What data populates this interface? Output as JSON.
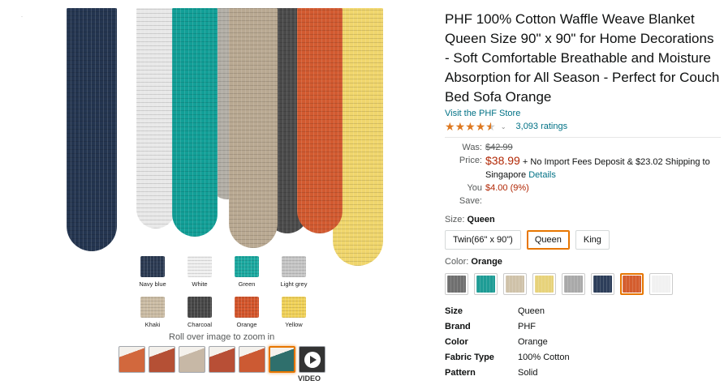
{
  "stray_mark": "·",
  "gallery": {
    "blankets": [
      {
        "color": "#243550"
      },
      {
        "color": "#e8e8e8"
      },
      {
        "color": "#129f97"
      },
      {
        "color": "#b2aea6"
      },
      {
        "color": "#b9a992"
      },
      {
        "color": "#4a4a4a"
      },
      {
        "color": "#d25a30"
      },
      {
        "color": "#f0d66c"
      }
    ],
    "swatches": [
      {
        "label": "Navy blue",
        "color": "#2b3a52"
      },
      {
        "label": "White",
        "color": "#efefef"
      },
      {
        "label": "Green",
        "color": "#1ba9a0"
      },
      {
        "label": "Light grey",
        "color": "#c6c6c6"
      },
      {
        "label": "Khaki",
        "color": "#cbbca4"
      },
      {
        "label": "Charcoal",
        "color": "#474747"
      },
      {
        "label": "Orange",
        "color": "#d4552b"
      },
      {
        "label": "Yellow",
        "color": "#f1d258"
      }
    ],
    "zoom_hint": "Roll over image to zoom in",
    "thumbnails": [
      {
        "color": "#d2683d",
        "selected": false
      },
      {
        "color": "#b55035",
        "selected": false
      },
      {
        "color": "#c7b8a6",
        "selected": false
      },
      {
        "color": "#b84f36",
        "selected": false
      },
      {
        "color": "#cc5a33",
        "selected": false
      },
      {
        "color": "#2f6f6c",
        "selected": true
      },
      {
        "color": "#333333",
        "selected": false,
        "video": true
      }
    ],
    "video_label": "VIDEO"
  },
  "product": {
    "title": "PHF 100% Cotton Waffle Weave Blanket Queen Size 90\" x 90\" for Home Decorations - Soft Comfortable Breathable and Moisture Absorption for All Season - Perfect for Couch Bed Sofa Orange",
    "store_link": "Visit the PHF Store",
    "rating_stars": 4.5,
    "rating_count": "3,093 ratings"
  },
  "pricing": {
    "was_label": "Was:",
    "was_value": "$42.99",
    "price_label": "Price:",
    "price_value": "$38.99",
    "price_extra": "+ No Import Fees Deposit & $23.02 Shipping to",
    "price_cont": "Singapore",
    "details_link": "Details",
    "save_label": "You Save:",
    "save_value": "$4.00 (9%)"
  },
  "size": {
    "label": "Size:",
    "selected": "Queen",
    "options": [
      {
        "label": "Twin(66\" x 90\")",
        "selected": false
      },
      {
        "label": "Queen",
        "selected": true
      },
      {
        "label": "King",
        "selected": false
      }
    ]
  },
  "color": {
    "label": "Color:",
    "selected": "Orange",
    "options": [
      {
        "color": "#6f6f6f",
        "selected": false
      },
      {
        "color": "#1e9c95",
        "selected": false
      },
      {
        "color": "#cfc2a9",
        "selected": false
      },
      {
        "color": "#e7d27a",
        "selected": false
      },
      {
        "color": "#a9a9a9",
        "selected": false
      },
      {
        "color": "#2d3e5a",
        "selected": false
      },
      {
        "color": "#d45d2e",
        "selected": true
      },
      {
        "color": "#f1f1f1",
        "selected": false
      }
    ]
  },
  "specs": [
    {
      "key": "Size",
      "value": "Queen"
    },
    {
      "key": "Brand",
      "value": "PHF"
    },
    {
      "key": "Color",
      "value": "Orange"
    },
    {
      "key": "Fabric Type",
      "value": "100% Cotton"
    },
    {
      "key": "Pattern",
      "value": "Solid"
    }
  ]
}
